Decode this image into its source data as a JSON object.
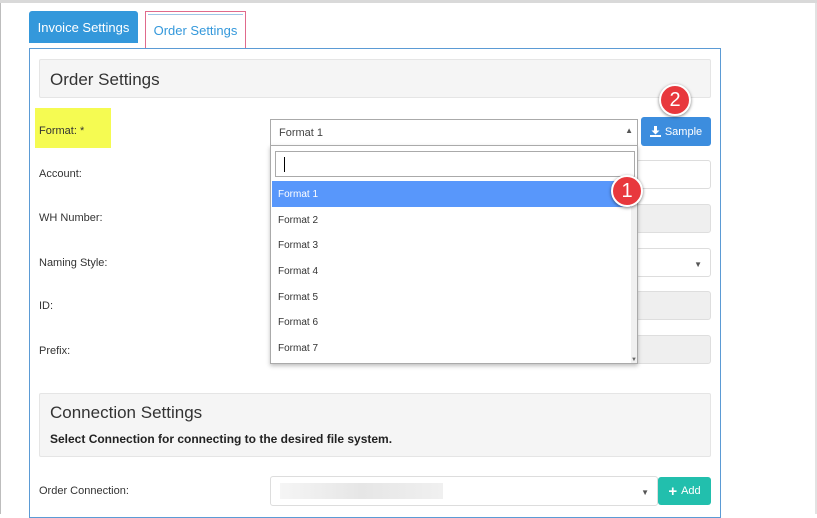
{
  "tabs": {
    "invoice": "Invoice Settings",
    "order": "Order Settings"
  },
  "order_section": {
    "title": "Order Settings",
    "fields": {
      "format": "Format: *",
      "account": "Account:",
      "wh_number": "WH Number:",
      "naming_style": "Naming Style:",
      "id": "ID:",
      "prefix": "Prefix:"
    },
    "format_select": {
      "selected": "Format 1",
      "search_value": "",
      "options": [
        "Format 1",
        "Format 2",
        "Format 3",
        "Format 4",
        "Format 5",
        "Format 6",
        "Format 7"
      ]
    },
    "sample_button": "Sample"
  },
  "connection_section": {
    "title": "Connection Settings",
    "subtitle": "Select Connection for connecting to the desired file system.",
    "order_connection_label": "Order Connection:",
    "add_button": "Add"
  },
  "callouts": {
    "one": "1",
    "two": "2"
  },
  "colors": {
    "primary": "#3498db",
    "highlight": "#f5fb52",
    "option_active": "#5897fb",
    "callout": "#e8383d",
    "add_button": "#22bfad"
  }
}
